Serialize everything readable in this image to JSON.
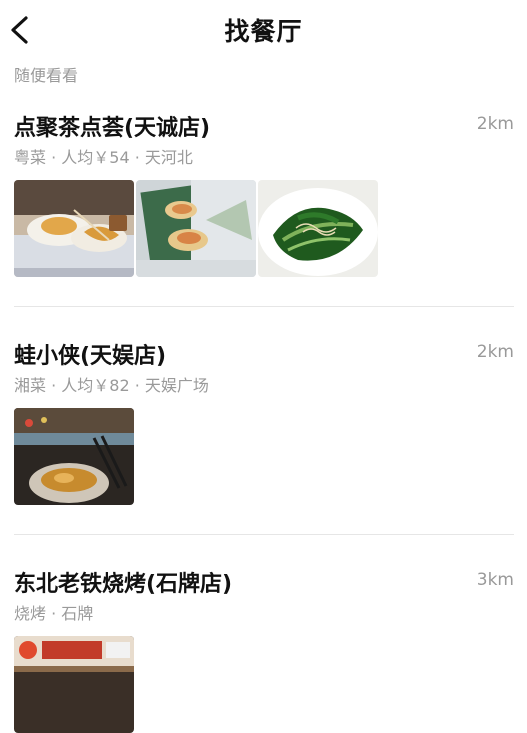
{
  "header": {
    "title": "找餐厅"
  },
  "section_label": "随便看看",
  "restaurants": [
    {
      "name": "点聚茶点荟(天诚店)",
      "meta": "粤菜 · 人均￥54 · 天河北",
      "distance": "2km",
      "photos": [
        "dim-sum-tea-photo",
        "shrimp-dumplings-photo",
        "choy-sum-greens-photo"
      ]
    },
    {
      "name": "蛙小侠(天娱店)",
      "meta": "湘菜 · 人均￥82 · 天娱广场",
      "distance": "2km",
      "photos": [
        "frog-hotpot-photo"
      ]
    },
    {
      "name": "东北老铁烧烤(石牌店)",
      "meta": "烧烤 · 石牌",
      "distance": "3km",
      "photos": [
        "bbq-storefront-photo"
      ]
    }
  ]
}
